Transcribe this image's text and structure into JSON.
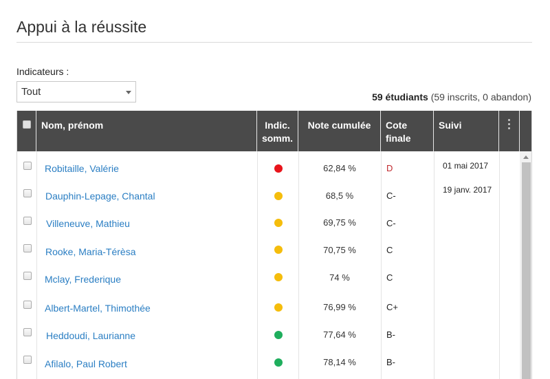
{
  "page": {
    "title": "Appui à la réussite"
  },
  "filter": {
    "label": "Indicateurs :",
    "selected": "Tout"
  },
  "summary": {
    "count": "59 étudiants",
    "detail": "(59 inscrits, 0 abandon)"
  },
  "table": {
    "headers": {
      "name": "Nom, prénom",
      "indic_line1": "Indic.",
      "indic_line2": "somm.",
      "note": "Note cumulée",
      "cote_line1": "Cote",
      "cote_line2": "finale",
      "suivi": "Suivi"
    },
    "rows": [
      {
        "name": "Robitaille, Valérie",
        "indicator": "red",
        "note": "62,84 %",
        "cote": "D",
        "suivi": "01 mai 2017"
      },
      {
        "name": "Dauphin-Lepage, Chantal",
        "indicator": "yellow",
        "note": "68,5 %",
        "cote": "C-",
        "suivi": "19 janv. 2017"
      },
      {
        "name": "Villeneuve, Mathieu",
        "indicator": "yellow",
        "note": "69,75 %",
        "cote": "C-",
        "suivi": ""
      },
      {
        "name": "Rooke, Maria-Térèsa",
        "indicator": "yellow",
        "note": "70,75 %",
        "cote": "C",
        "suivi": ""
      },
      {
        "name": "Mclay, Frederique",
        "indicator": "yellow",
        "note": "74 %",
        "cote": "C",
        "suivi": ""
      },
      {
        "name": "Albert-Martel, Thimothée",
        "indicator": "yellow",
        "note": "76,99 %",
        "cote": "C+",
        "suivi": ""
      },
      {
        "name": "Heddoudi, Laurianne",
        "indicator": "green",
        "note": "77,64 %",
        "cote": "B-",
        "suivi": ""
      },
      {
        "name": "Afilalo, Paul Robert",
        "indicator": "green",
        "note": "78,14 %",
        "cote": "B-",
        "suivi": ""
      }
    ]
  },
  "colors": {
    "header_bg": "#4a4a4a",
    "link": "#2a7ec3",
    "red": "#e8141b",
    "yellow": "#f5bd0c",
    "green": "#1fae5d",
    "grade_d": "#c0282d"
  }
}
